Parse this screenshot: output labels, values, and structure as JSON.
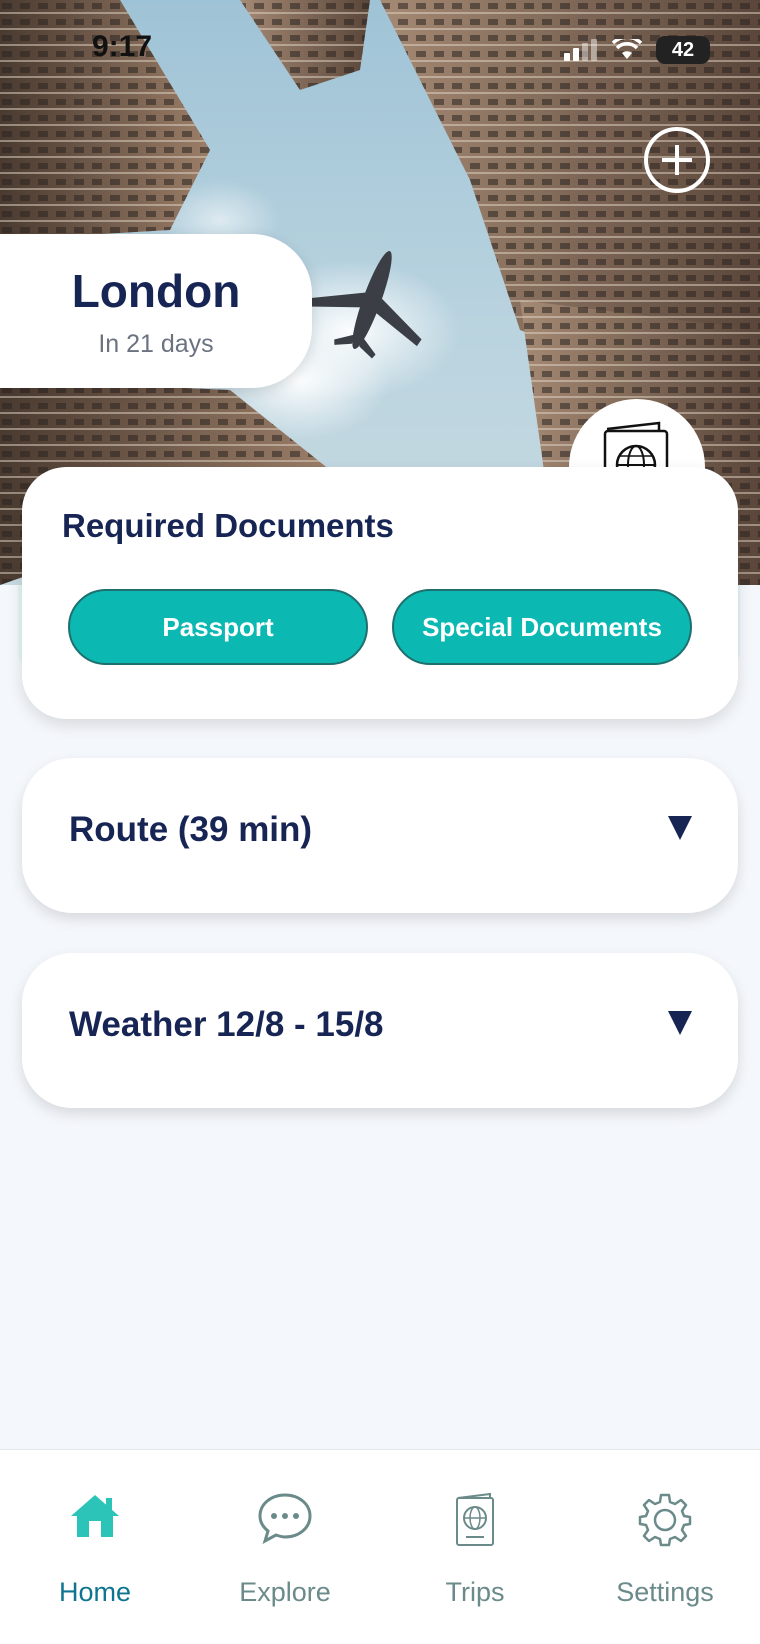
{
  "status_bar": {
    "time": "9:17",
    "battery": "42"
  },
  "trip": {
    "city": "London",
    "countdown": "In 21 days"
  },
  "documents": {
    "title": "Required Documents",
    "buttons": [
      "Passport",
      "Special Documents"
    ]
  },
  "sections": [
    {
      "title": "Route (39 min)"
    },
    {
      "title": "Weather 12/8 - 15/8"
    }
  ],
  "tab_bar": {
    "items": [
      {
        "label": "Home",
        "icon": "home-icon",
        "active": true
      },
      {
        "label": "Explore",
        "icon": "chat-bubble-icon",
        "active": false
      },
      {
        "label": "Trips",
        "icon": "passport-icon",
        "active": false
      },
      {
        "label": "Settings",
        "icon": "gear-icon",
        "active": false
      }
    ]
  },
  "colors": {
    "accent": "#0bb8b2",
    "navy": "#172554",
    "background": "#f4f7fb",
    "active_tab": "#0e7490"
  }
}
